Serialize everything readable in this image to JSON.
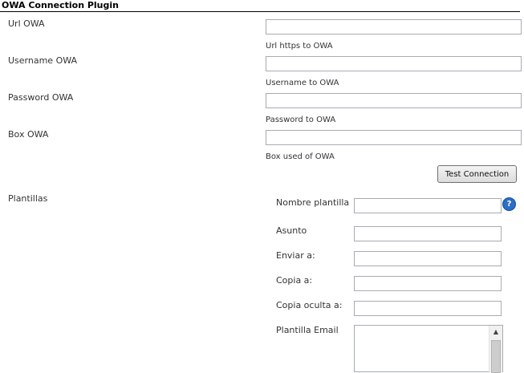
{
  "section": {
    "title": "OWA Connection Plugin"
  },
  "fields": {
    "url": {
      "label": "Url OWA",
      "value": "",
      "help": "Url https to OWA"
    },
    "username": {
      "label": "Username OWA",
      "value": "",
      "help": "Username to OWA"
    },
    "password": {
      "label": "Password OWA",
      "value": "",
      "help": "Password to OWA"
    },
    "box": {
      "label": "Box OWA",
      "value": "",
      "help": "Box used of OWA"
    }
  },
  "test_button": {
    "label": "Test Connection"
  },
  "templates": {
    "label": "Plantillas",
    "nombre": {
      "label": "Nombre plantilla",
      "value": ""
    },
    "asunto": {
      "label": "Asunto",
      "value": ""
    },
    "enviar": {
      "label": "Enviar a:",
      "value": ""
    },
    "copia": {
      "label": "Copia a:",
      "value": ""
    },
    "copia_oculta": {
      "label": "Copia oculta a:",
      "value": ""
    },
    "email": {
      "label": "Plantilla Email",
      "value": ""
    },
    "help_icon": "question-mark-icon"
  },
  "colors": {
    "help_icon": "#2a6fc9",
    "input_border": "#a5acb2"
  }
}
